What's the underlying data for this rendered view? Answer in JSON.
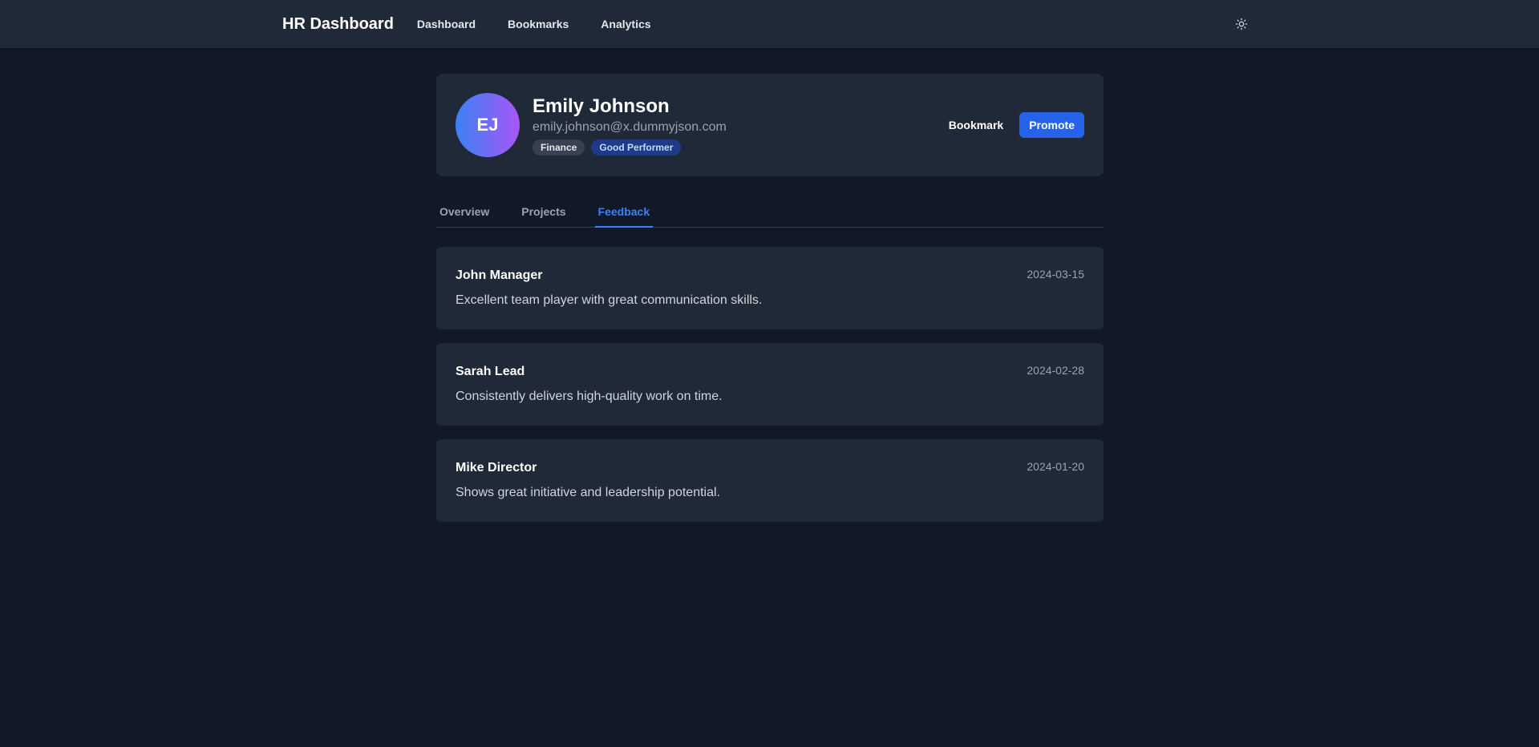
{
  "navbar": {
    "brand": "HR Dashboard",
    "links": [
      "Dashboard",
      "Bookmarks",
      "Analytics"
    ],
    "theme_toggle_icon": "sun-icon"
  },
  "profile": {
    "initials": "EJ",
    "name": "Emily Johnson",
    "email": "emily.johnson@x.dummyjson.com",
    "department": "Finance",
    "performance": "Good Performer",
    "bookmark_label": "Bookmark",
    "promote_label": "Promote"
  },
  "tabs": [
    {
      "label": "Overview",
      "active": false
    },
    {
      "label": "Projects",
      "active": false
    },
    {
      "label": "Feedback",
      "active": true
    }
  ],
  "feedback": [
    {
      "author": "John Manager",
      "date": "2024-03-15",
      "text": "Excellent team player with great communication skills."
    },
    {
      "author": "Sarah Lead",
      "date": "2024-02-28",
      "text": "Consistently delivers high-quality work on time."
    },
    {
      "author": "Mike Director",
      "date": "2024-01-20",
      "text": "Shows great initiative and leadership potential."
    }
  ],
  "colors": {
    "background": "#111827",
    "card": "#1f2937",
    "accent": "#2563eb",
    "tab_active": "#3b82f6"
  }
}
